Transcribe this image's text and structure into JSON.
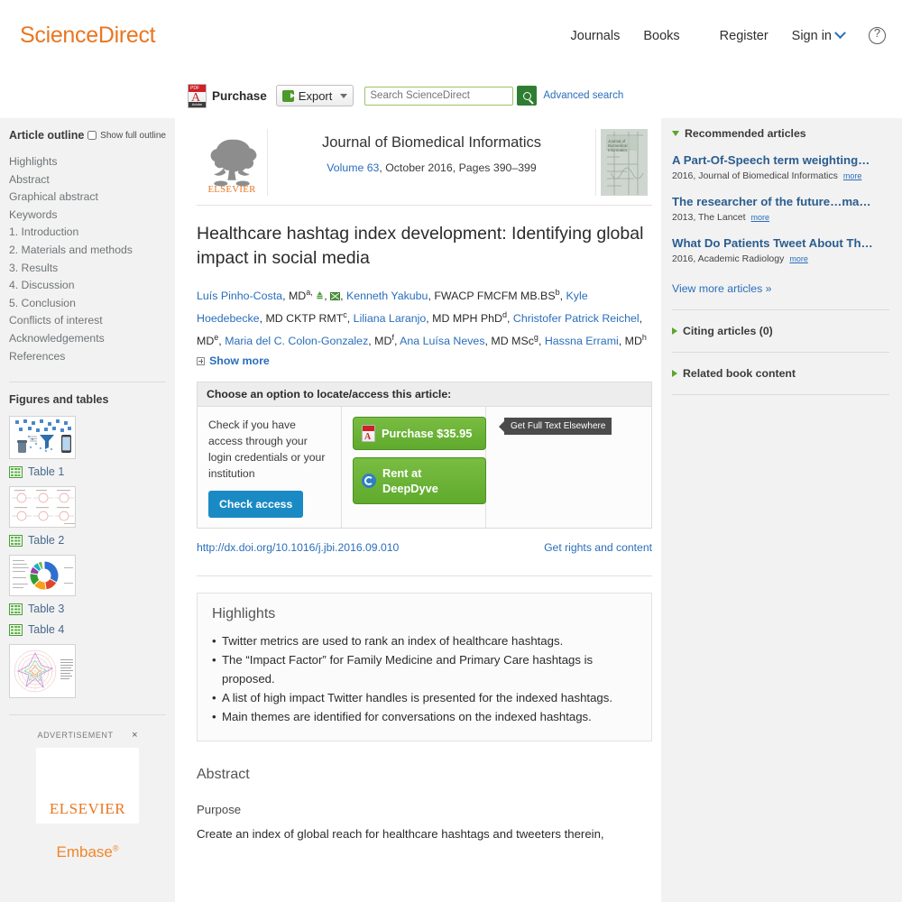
{
  "header": {
    "brand": "ScienceDirect",
    "nav": [
      {
        "label": "Journals"
      },
      {
        "label": "Books"
      },
      {
        "label": "Register"
      },
      {
        "label": "Sign in"
      }
    ],
    "help_icon": "question-circle-icon"
  },
  "toolbar": {
    "pdf_icon": "pdf-icon",
    "pdf_badge": "PDF",
    "pdf_foot": "Adobe",
    "purchase_label": "Purchase",
    "export_label": "Export",
    "search_placeholder": "Search ScienceDirect",
    "search_value": "",
    "advanced_search_label": "Advanced search"
  },
  "sidebar": {
    "outline_title": "Article outline",
    "show_full_outline_label": "Show full outline",
    "outline_items": [
      {
        "label": "Highlights"
      },
      {
        "label": "Abstract"
      },
      {
        "label": "Graphical abstract"
      },
      {
        "label": "Keywords"
      },
      {
        "label": "1. Introduction"
      },
      {
        "label": "2. Materials and methods"
      },
      {
        "label": "3. Results"
      },
      {
        "label": "4. Discussion"
      },
      {
        "label": "5. Conclusion"
      },
      {
        "label": "Conflicts of interest"
      },
      {
        "label": "Acknowledgements"
      },
      {
        "label": "References"
      }
    ],
    "figures_title": "Figures and tables",
    "table_links": [
      {
        "label": "Table 1"
      },
      {
        "label": "Table 2"
      },
      {
        "label": "Table 3"
      },
      {
        "label": "Table 4"
      }
    ],
    "ad": {
      "label": "ADVERTISEMENT",
      "close": "×",
      "brand": "ELSEVIER",
      "product": "Embase",
      "product_mark": "®"
    }
  },
  "journal": {
    "publisher": "ELSEVIER",
    "title": "Journal of Biomedical Informatics",
    "volume_link": "Volume 63",
    "volume_rest": ", October 2016, Pages 390–399"
  },
  "article": {
    "title": "Healthcare hashtag index development: Identifying global impact in social media",
    "authors_html_parts": {
      "a1_name": "Luís Pinho-Costa",
      "a1_deg": ", MD",
      "a1_sup": "a,",
      "a2_name": "Kenneth Yakubu",
      "a2_deg": ", FWACP FMCFM MB.BS",
      "a2_sup": "b",
      "a3_name": "Kyle Hoedebecke",
      "a3_deg": ", MD CKTP RMT",
      "a3_sup": "c",
      "a4_name": "Liliana Laranjo",
      "a4_deg": ", MD MPH PhD",
      "a4_sup": "d",
      "a5_name": "Christofer Patrick Reichel",
      "a5_deg": ", MD",
      "a5_sup": "e",
      "a6_name": "Maria del C. Colon-Gonzalez",
      "a6_deg": ", MD",
      "a6_sup": "f",
      "a7_name": "Ana Luísa Neves",
      "a7_deg": ", MD MSc",
      "a7_sup": "g",
      "a8_name": "Hassna Errami",
      "a8_deg": ", MD",
      "a8_sup": "h"
    },
    "show_more_label": "Show more",
    "doi": "http://dx.doi.org/10.1016/j.jbi.2016.09.010",
    "rights_label": "Get rights and content"
  },
  "access": {
    "heading": "Choose an option to locate/access this article:",
    "check_text": "Check if you have access through your login credentials or your institution",
    "check_button": "Check access",
    "purchase_button": "Purchase $35.95",
    "rent_button": "Rent at DeepDyve",
    "tooltip": "Get Full Text Elsewhere"
  },
  "highlights": {
    "title": "Highlights",
    "items": [
      "Twitter metrics are used to rank an index of healthcare hashtags.",
      "The “Impact Factor” for Family Medicine and Primary Care hashtags is proposed.",
      "A list of high impact Twitter handles is presented for the indexed hashtags.",
      "Main themes are identified for conversations on the indexed hashtags."
    ]
  },
  "abstract": {
    "title": "Abstract",
    "subhead": "Purpose",
    "text": "Create an index of global reach for healthcare hashtags and tweeters therein,"
  },
  "right": {
    "recommended_title": "Recommended articles",
    "recommended": [
      {
        "title": "A Part-Of-Speech term weighting…",
        "meta": "2016, Journal of Biomedical Informatics",
        "more": "more"
      },
      {
        "title": "The researcher of the future…ma…",
        "meta": "2013, The Lancet",
        "more": "more"
      },
      {
        "title": "What Do Patients Tweet About Th…",
        "meta": "2016, Academic Radiology",
        "more": "more"
      }
    ],
    "view_more": "View more articles »",
    "citing_articles": "Citing articles (0)",
    "related_book": "Related book content"
  },
  "colors": {
    "brand_orange": "#e87722",
    "link_blue": "#2a6ebb",
    "green_button": "#5faa2c",
    "blue_button": "#1a8ac4",
    "sidebar_gray": "#f2f2f2"
  }
}
